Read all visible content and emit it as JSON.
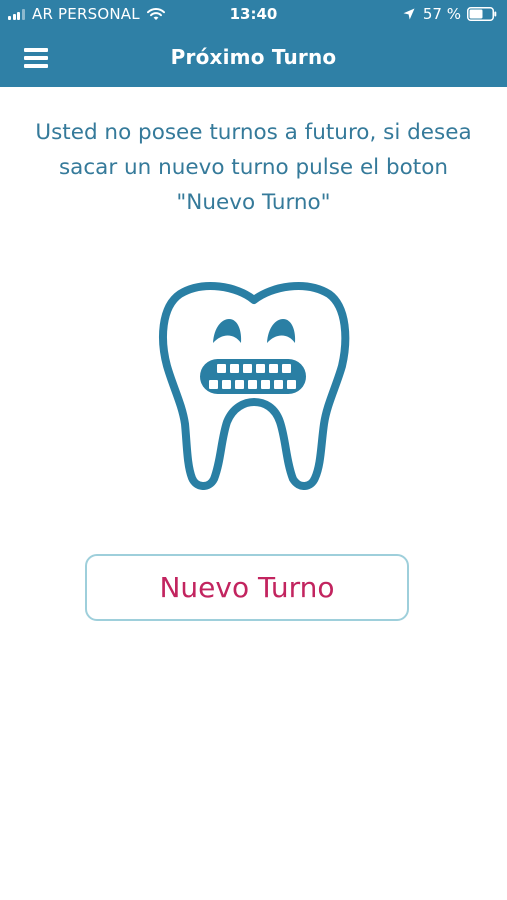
{
  "status_bar": {
    "carrier": "AR PERSONAL",
    "time": "13:40",
    "battery": "57 %"
  },
  "header": {
    "title": "Próximo Turno",
    "menu_icon": "hamburger-menu-icon"
  },
  "main": {
    "message": "Usted no posee turnos a futuro, si desea sacar un nuevo turno pulse el boton \"Nuevo Turno\"",
    "illustration_icon": "tooth-with-braces-icon",
    "new_turn_button_label": "Nuevo Turno"
  },
  "colors": {
    "header_bg": "#2f80a6",
    "message_text": "#357a9a",
    "tooth_stroke": "#2a7fa4",
    "button_text": "#c2245f",
    "button_border": "#9ecfdb"
  }
}
